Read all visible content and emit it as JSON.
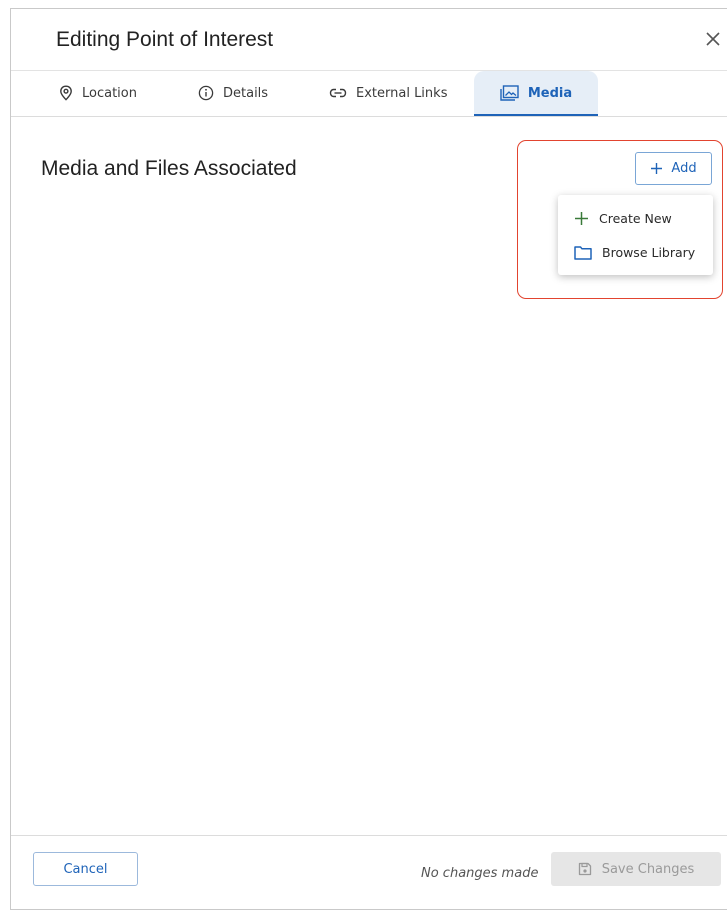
{
  "dialog": {
    "title": "Editing Point of Interest",
    "close_icon": "close-icon"
  },
  "tabs": [
    {
      "label": "Location",
      "icon": "map-pin-icon",
      "active": false
    },
    {
      "label": "Details",
      "icon": "info-circle-icon",
      "active": false
    },
    {
      "label": "External Links",
      "icon": "link-icon",
      "active": false
    },
    {
      "label": "Media",
      "icon": "image-gallery-icon",
      "active": true
    }
  ],
  "main": {
    "section_title": "Media and Files Associated",
    "add_button": {
      "label": "Add",
      "icon": "plus-icon"
    },
    "add_menu": [
      {
        "label": "Create New",
        "icon": "plus-icon",
        "icon_color": "#3a7a3a"
      },
      {
        "label": "Browse Library",
        "icon": "folder-icon",
        "icon_color": "#1e63b8"
      }
    ]
  },
  "footer": {
    "cancel_label": "Cancel",
    "status_text": "No changes made",
    "save_label": "Save Changes",
    "save_icon": "save-disk-icon"
  },
  "colors": {
    "accent": "#1e63b8",
    "active_tab_bg": "#e6eef7",
    "highlight": "#e2442f",
    "disabled_bg": "#e6e6e6"
  }
}
